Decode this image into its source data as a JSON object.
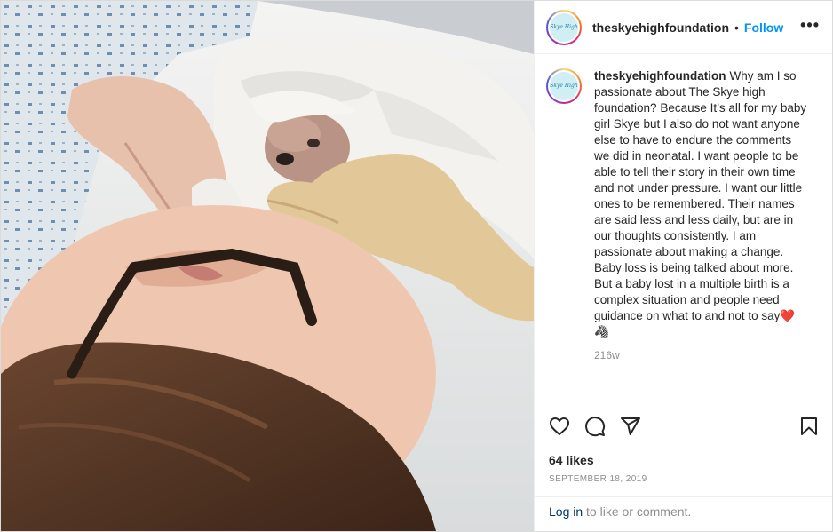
{
  "post": {
    "username": "theskyehighfoundation",
    "separator": "•",
    "follow_label": "Follow",
    "more_label": "•••",
    "avatar_text": "Skye High",
    "caption": "Why am I so passionate about The Skye high foundation? Because It’s all for my baby girl Skye but I also do not want anyone else to have to endure the comments we did in neonatal. I want people to be able to tell their story in their own time and not under pressure. I want our little ones to be remembered. Their names are said less and less daily, but are in our thoughts consistently. I am passionate about making a change. Baby loss is being talked about more. But a baby lost in a multiple birth is a complex situation and people need guidance on what to and not to say❤️🦓",
    "caption_age": "216w",
    "likes": "64 likes",
    "date": "SEPTEMBER 18, 2019",
    "login_link": "Log in",
    "login_rest": " to like or comment."
  },
  "icons": {
    "like": "heart-icon",
    "comment": "comment-bubble-icon",
    "share": "paper-plane-icon",
    "save": "bookmark-icon"
  },
  "colors": {
    "link_blue": "#0095f6",
    "muted": "#8e8e8e",
    "text": "#262626",
    "border": "#dbdbdb"
  }
}
